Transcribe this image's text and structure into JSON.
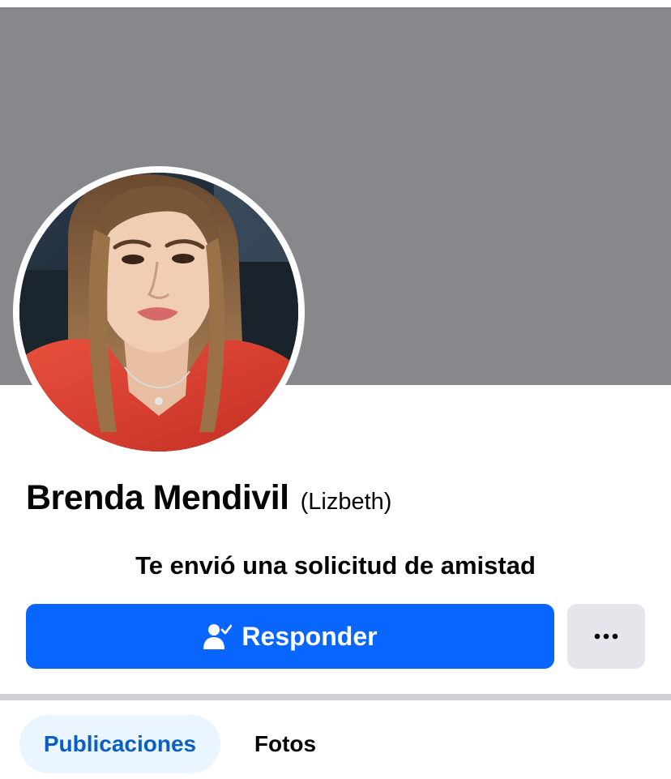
{
  "profile": {
    "name": "Brenda Mendivil",
    "alternate_name": "(Lizbeth)",
    "friend_request_text": "Te envió una solicitud de amistad",
    "avatar_icon": "profile-photo"
  },
  "actions": {
    "respond_label": "Responder",
    "respond_icon": "person-check-icon",
    "more_icon": "more-dots-icon"
  },
  "tabs": [
    {
      "label": "Publicaciones",
      "active": true
    },
    {
      "label": "Fotos",
      "active": false
    }
  ],
  "colors": {
    "cover": "#87888c",
    "primary_button": "#0866ff",
    "secondary_button": "#e4e6eb",
    "active_tab_bg": "#ebf5ff",
    "active_tab_text": "#0a5fc7"
  }
}
